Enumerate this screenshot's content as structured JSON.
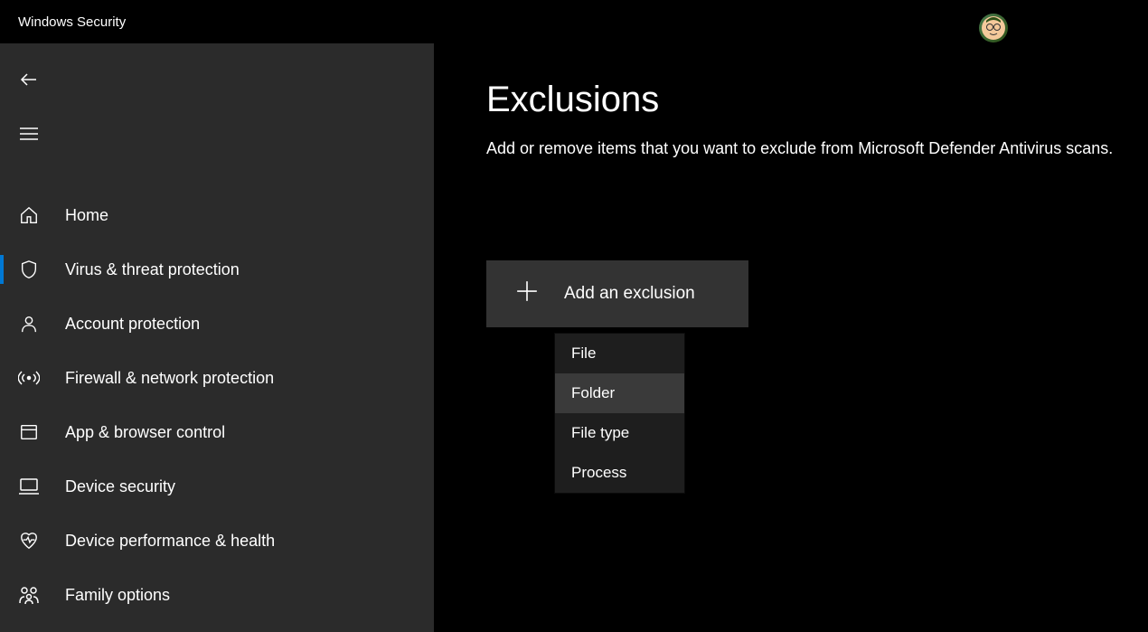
{
  "app": {
    "title": "Windows Security"
  },
  "sidebar": {
    "items": [
      {
        "icon": "home-icon",
        "label": "Home"
      },
      {
        "icon": "shield-icon",
        "label": "Virus & threat protection",
        "active": true
      },
      {
        "icon": "person-icon",
        "label": "Account protection"
      },
      {
        "icon": "signal-icon",
        "label": "Firewall & network protection"
      },
      {
        "icon": "app-icon",
        "label": "App & browser control"
      },
      {
        "icon": "device-icon",
        "label": "Device security"
      },
      {
        "icon": "heart-icon",
        "label": "Device performance & health"
      },
      {
        "icon": "family-icon",
        "label": "Family options"
      }
    ]
  },
  "page": {
    "title": "Exclusions",
    "description": "Add or remove items that you want to exclude from Microsoft Defender Antivirus scans.",
    "add_button_label": "Add an exclusion"
  },
  "dropdown": {
    "items": [
      {
        "label": "File"
      },
      {
        "label": "Folder",
        "hover": true
      },
      {
        "label": "File type"
      },
      {
        "label": "Process"
      }
    ]
  }
}
